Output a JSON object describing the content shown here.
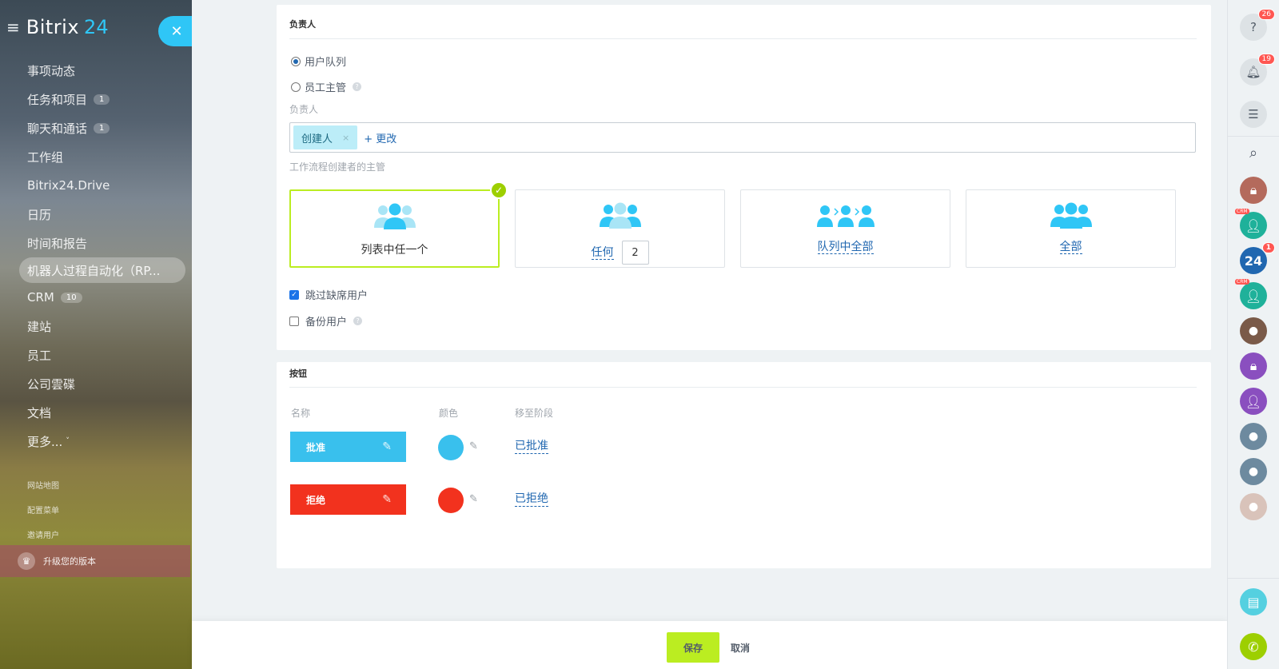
{
  "sidebar": {
    "logo": "Bitrix",
    "logo_suffix": "24",
    "items": [
      {
        "label": "事项动态"
      },
      {
        "label": "任务和项目",
        "badge": "1"
      },
      {
        "label": "聊天和通话",
        "badge": "1"
      },
      {
        "label": "工作组"
      },
      {
        "label": "Bitrix24.Drive"
      },
      {
        "label": "日历"
      },
      {
        "label": "时间和报告"
      },
      {
        "label": "机器人过程自动化（RP..."
      },
      {
        "label": "CRM",
        "badge": "10"
      },
      {
        "label": "建站"
      },
      {
        "label": "员工"
      },
      {
        "label": "公司雲碟"
      },
      {
        "label": "文档"
      },
      {
        "label": "更多..."
      }
    ],
    "small_links": [
      "网站地图",
      "配置菜单",
      "邀请用户"
    ],
    "upgrade": "升级您的版本"
  },
  "responsible": {
    "title": "负责人",
    "radio_queue": "用户队列",
    "radio_manager": "员工主管",
    "field_label": "负责人",
    "tag": "创建人",
    "tag_remove": "×",
    "change": "+ 更改",
    "workflow_label": "工作流程创建者的主管",
    "options": [
      {
        "label": "列表中任一个"
      },
      {
        "label": "任何",
        "count": "2"
      },
      {
        "label": "队列中全部"
      },
      {
        "label": "全部"
      }
    ],
    "skip_absent": "跳过缺席用户",
    "backup_user": "备份用户"
  },
  "buttons": {
    "title": "按钮",
    "col_name": "名称",
    "col_color": "颜色",
    "col_stage": "移至阶段",
    "rows": [
      {
        "label": "批准",
        "color": "#39c0ed",
        "stage": "已批准"
      },
      {
        "label": "拒绝",
        "color": "#f2321e",
        "stage": "已拒绝"
      }
    ]
  },
  "footer": {
    "save": "保存",
    "cancel": "取消"
  },
  "rightbar": {
    "help_count": "26",
    "notify_count": "19",
    "crm_tag": "CRM",
    "chat24_label": "24",
    "chat24_count": "1"
  },
  "colors": {
    "accent": "#2fc6f6",
    "save_green": "#bbed21",
    "link_blue": "#2067b0",
    "selected_border": "#bbed21"
  }
}
